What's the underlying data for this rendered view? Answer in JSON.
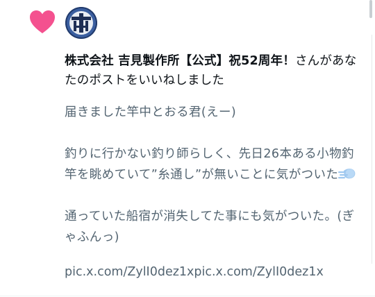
{
  "notification": {
    "actor_name": "株式会社 吉見製作所【公式】祝52周年！",
    "action_text": "さんがあなたのポストをいいねしました",
    "post_paragraphs": [
      "届きました竿中とおる君(えー)",
      "釣りに行かない釣り師らしく、先日26本ある小物釣竿を眺めていて”糸通し”が無いことに気がついた",
      "通っていた船宿が消失してた事にも気がついた。(ぎゃふんっ)"
    ],
    "post_links": [
      "pic.x.com/ZylI0dez1x",
      "pic.x.com/ZylI0dez1x"
    ],
    "icons": {
      "notification_type": "heart-icon",
      "emoji": "dash-icon"
    },
    "colors": {
      "heart": "#f4518f",
      "primary_text": "#0f1419",
      "secondary_text": "#536471"
    }
  }
}
